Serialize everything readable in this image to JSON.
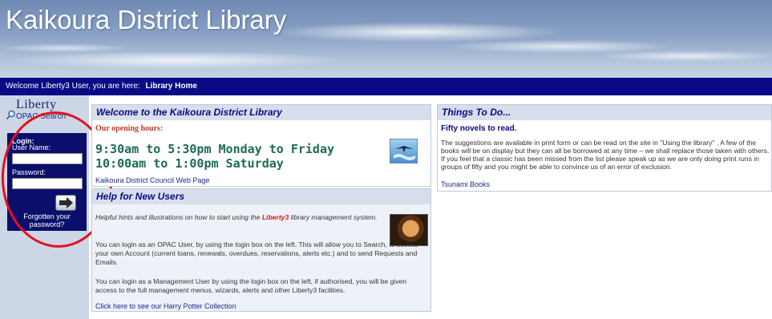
{
  "banner": {
    "title": "Kaikoura District Library"
  },
  "nav": {
    "welcome": "Welcome Liberty3 User,  you are here:",
    "crumb": "Library Home"
  },
  "sidebar": {
    "logo": "Liberty",
    "opac_link": "OPAC Search",
    "login": {
      "heading": "Login:",
      "username_label": "User Name:",
      "username_value": "",
      "password_label": "Password:",
      "password_value": "",
      "forgot": "Forgotten your password?"
    }
  },
  "welcome": {
    "title": "Welcome to the Kaikoura District Library",
    "hours_label": "Our opening hours:",
    "hours_line1": "9:30am to 5:30pm Monday to Friday",
    "hours_line2": "10:00am to 1:00pm Saturday",
    "council_link": "Kaikoura District Council Web Page"
  },
  "help": {
    "title": "Help for New Users",
    "intro_before": "Helpful hints and illustrations on how to start using the ",
    "intro_brand": "Liberty3",
    "intro_after": " library management system.",
    "para_opac": "You can login as an OPAC User, by using the login box on the left. This will allow you to Search, to access your own Account (current loans, renewals, overdues, reservations, alerts etc.) and to send Requests and Emails.",
    "para_mgmt": "You can login as a Management User by using the login box on the left, if authorised, you will be given access to the full management menus, wizards, alerts and other Liberty3 facilities.",
    "hp_link": "Click here to see our Harry Potter Collection"
  },
  "things": {
    "title": "Things To Do...",
    "subtitle": "Fifty novels to read.",
    "body": "The suggestions are available in print form or can be read on the site in \"Using the library\" . A few of the books will be on display but they can all be borrowed at any time – we shall replace those taken with others. If you feel that a classic has been missed from the list please speak up as we are only doing print runs in groups of fifty and you might be able to convince us of an error of exclusion.",
    "link": "Tsunami Books"
  },
  "colors": {
    "navbar": "#0a0a86",
    "annotation_circle": "#e3111b",
    "panel_head": "#d7dfec"
  }
}
